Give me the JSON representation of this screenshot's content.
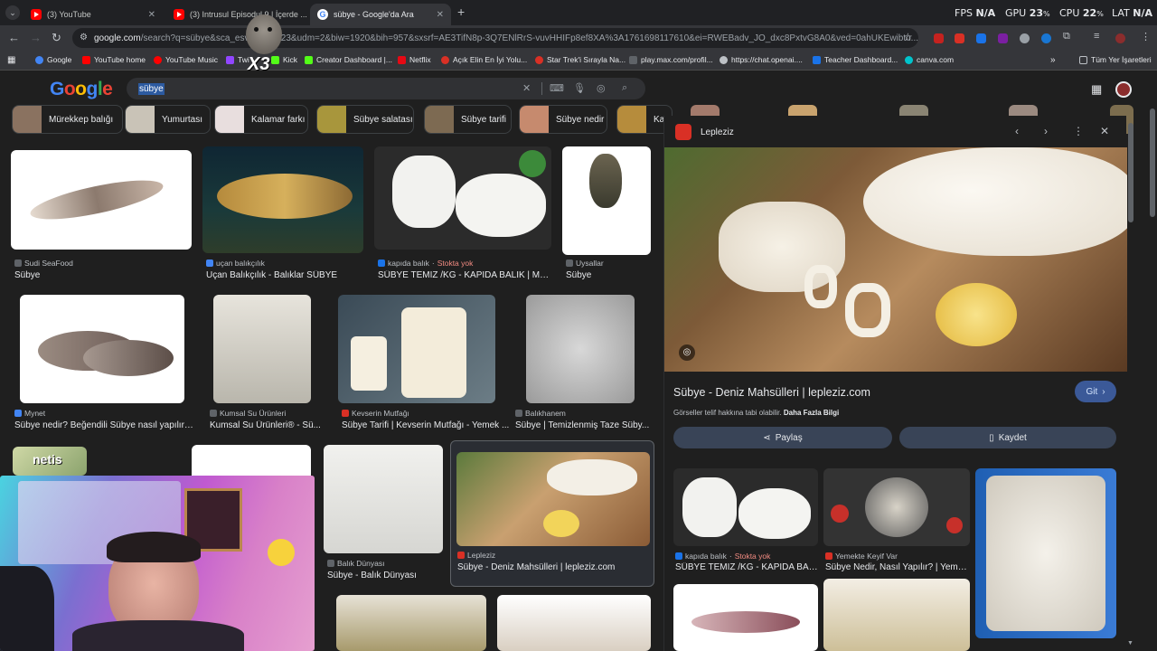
{
  "tabs": [
    {
      "label": "(3) YouTube",
      "icon": "youtube-icon",
      "active": false
    },
    {
      "label": "(3) Intrusul Episodul 9 | İçerde ...",
      "icon": "youtube-icon",
      "active": false
    },
    {
      "label": "sübye - Google'da Ara",
      "icon": "google-icon",
      "active": true
    }
  ],
  "new_tab": "+",
  "system_stats": {
    "fps_label": "FPS",
    "fps_value": "N/A",
    "gpu_label": "GPU",
    "gpu_value": "23",
    "cpu_label": "CPU",
    "cpu_value": "22",
    "lat_label": "LAT",
    "lat_value": "N/A",
    "percent": "%"
  },
  "address_bar": {
    "host": "google.com",
    "path": "/search?q=sübye&sca_esv=",
    "path_rest": "6a2e23&udm=2&biw=1920&bih=957&sxsrf=AE3TifN8p-3Q7ENlRrS-vuvHHIFp8ef8XA%3A1761698117610&ei=RWEBadv_JO_dxc8PxtvG8A0&ved=0ahUKEwibto..."
  },
  "overlay_badge": "X3",
  "bookmarks": [
    {
      "label": "Google",
      "color": "#4285f4"
    },
    {
      "label": "YouTube home",
      "color": "#ff0000"
    },
    {
      "label": "YouTube Music",
      "color": "#ff0000"
    },
    {
      "label": "Twi",
      "color": "#9146ff"
    },
    {
      "label": "Kick",
      "color": "#53fc18"
    },
    {
      "label": "Creator Dashboard |...",
      "color": "#53fc18"
    },
    {
      "label": "Netflix",
      "color": "#e50914"
    },
    {
      "label": "Açık Elin En İyi Yolu...",
      "color": "#d93025"
    },
    {
      "label": "Star Trek'i Sırayla Na...",
      "color": "#d93025"
    },
    {
      "label": "play.max.com/profil...",
      "color": "#5f6368"
    },
    {
      "label": "https://chat.openai....",
      "color": "#bdc1c6"
    },
    {
      "label": "Teacher Dashboard...",
      "color": "#1a73e8"
    },
    {
      "label": "canva.com",
      "color": "#00c4cc"
    }
  ],
  "bookmarks_more": "»",
  "other_bookmarks": "Tüm Yer İşaretleri",
  "google": {
    "logo": [
      "G",
      "o",
      "o",
      "g",
      "l",
      "e"
    ],
    "logo_colors": [
      "#4285f4",
      "#ea4335",
      "#fbbc05",
      "#4285f4",
      "#34a853",
      "#ea4335"
    ],
    "query": "sübye"
  },
  "chips": [
    {
      "label": "Mürekkep balığı",
      "color": "#8a7260"
    },
    {
      "label": "Yumurtası",
      "color": "#c9c3b7"
    },
    {
      "label": "Kalamar farkı",
      "color": "#e8dede"
    },
    {
      "label": "Sübye salatası",
      "color": "#a8963c"
    },
    {
      "label": "Sübye tarifi",
      "color": "#7d6a52"
    },
    {
      "label": "Sübye nedir",
      "color": "#c68a6e"
    },
    {
      "label": "Ka",
      "color": "#b68c3c"
    }
  ],
  "results": [
    {
      "source": "Sudi SeaFood",
      "title": "Sübye",
      "oos": ""
    },
    {
      "source": "uçan balıkçılık",
      "title": "Uçan Balıkçılık - Balıklar SÜBYE",
      "oos": ""
    },
    {
      "source": "kapıda balık",
      "title": "SÜBYE TEMİZ /KG - KAPIDA BALIK | Ma...",
      "oos": "Stokta yok"
    },
    {
      "source": "Uysallar",
      "title": "Sübye",
      "oos": ""
    },
    {
      "source": "Mynet",
      "title": "Sübye nedir? Beğendili Sübye nasıl yapılır?...",
      "oos": ""
    },
    {
      "source": "Kumsal Su Ürünleri",
      "title": "Kumsal Su Ürünleri® - Sü...",
      "oos": ""
    },
    {
      "source": "Kevserin Mutfağı",
      "title": "Sübye Tarifi | Kevserin Mutfağı - Yemek ...",
      "oos": ""
    },
    {
      "source": "Balıkhanem",
      "title": "Sübye | Temizlenmiş Taze Süby...",
      "oos": ""
    },
    {
      "source": "Balık Dünyası",
      "title": "Sübye - Balık Dünyası",
      "oos": ""
    },
    {
      "source": "Lepleziz",
      "title": "Sübye - Deniz Mahsülleri | lepleziz.com",
      "oos": ""
    }
  ],
  "webcam_label": "netis",
  "panel": {
    "site": "Lepleziz",
    "title": "Sübye - Deniz Mahsülleri | lepleziz.com",
    "go_label": "Git",
    "copyright": "Görseller telif hakkına tabi olabilir.",
    "more_info": "Daha Fazla Bilgi",
    "share_label": "Paylaş",
    "save_label": "Kaydet",
    "related": [
      {
        "source": "kapıda balık",
        "oos": "Stokta yok",
        "title": "SÜBYE TEMİZ /KG - KAPIDA BALI..."
      },
      {
        "source": "Yemekte Keyif Var",
        "oos": "",
        "title": "Sübye Nedir, Nasıl Yapılır? | Yeme..."
      }
    ]
  },
  "colors": {
    "accent": "#8ab4f8",
    "panel_button": "#394457",
    "go_button": "#1a73e8"
  }
}
